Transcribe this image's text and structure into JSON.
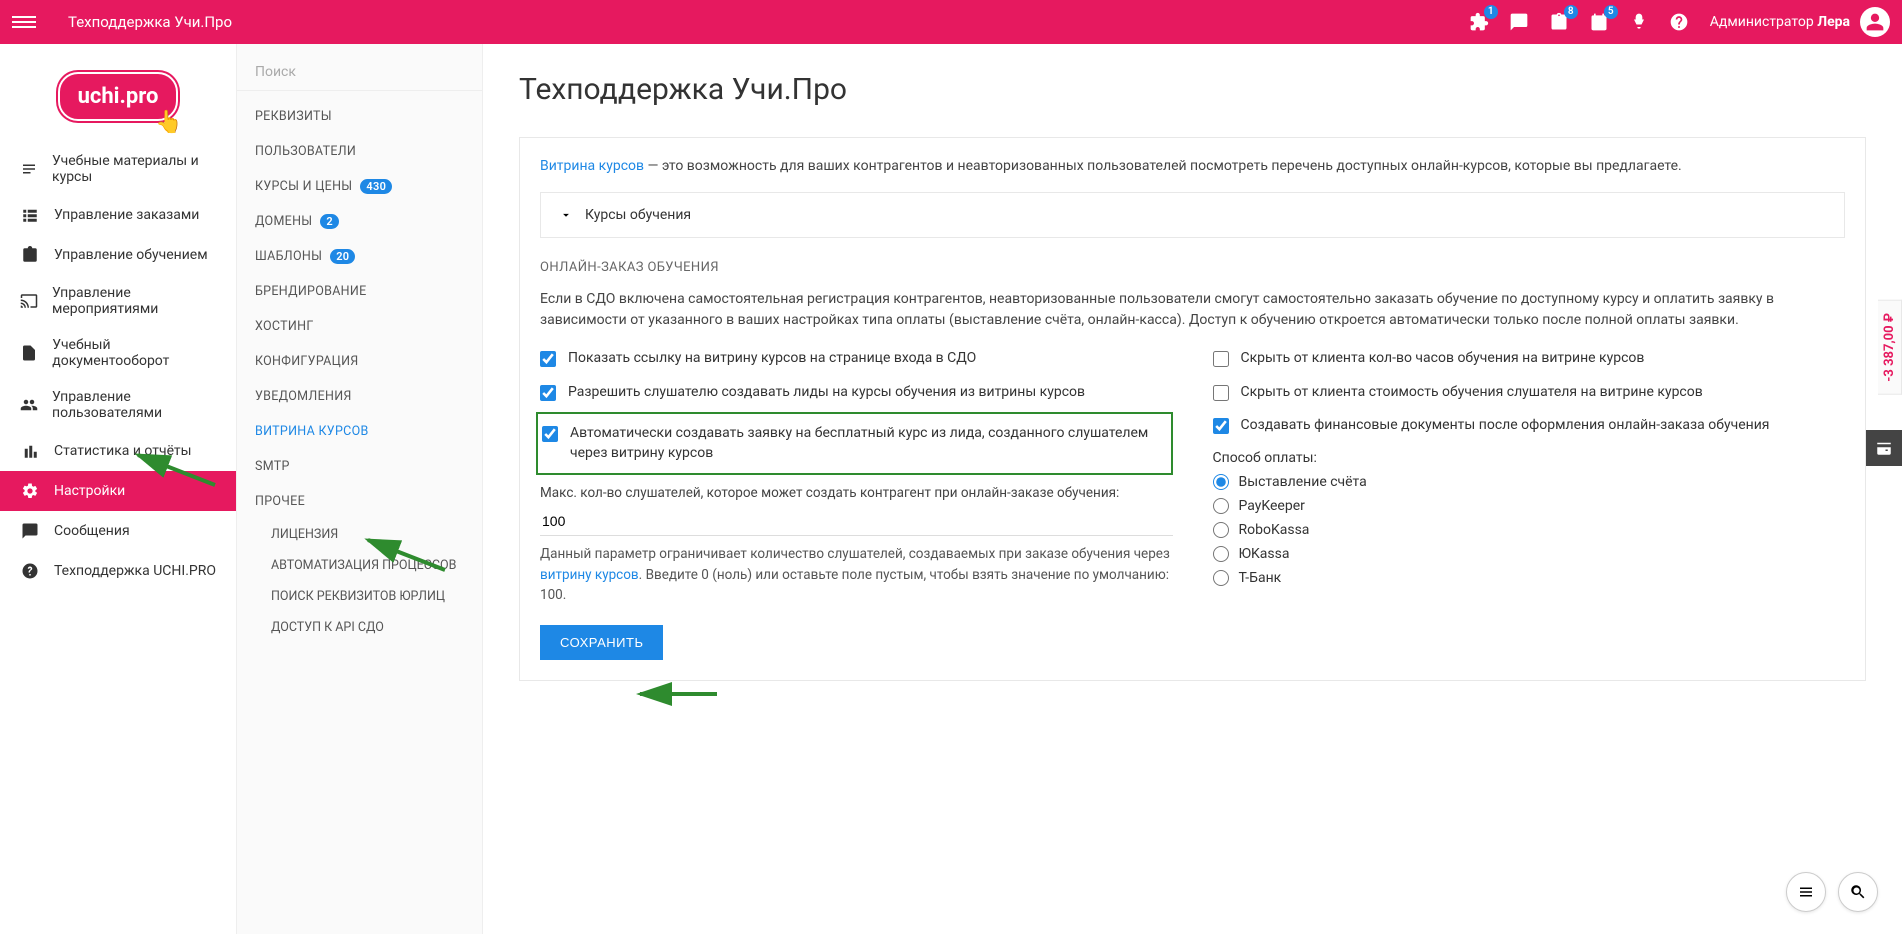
{
  "header": {
    "app_title": "Техподдержка Учи.Про",
    "badges": {
      "b1": "1",
      "b2": "8",
      "b3": "5"
    },
    "user_prefix": "Администратор",
    "user_name": "Лера"
  },
  "sidebar1": {
    "items": [
      "Учебные материалы и курсы",
      "Управление заказами",
      "Управление обучением",
      "Управление мероприятиями",
      "Учебный документооборот",
      "Управление пользователями",
      "Статистика и отчёты",
      "Настройки",
      "Сообщения",
      "Техподдержка UCHI.PRO"
    ],
    "active_index": 7
  },
  "sidebar2": {
    "search_placeholder": "Поиск",
    "items": [
      {
        "label": "РЕКВИЗИТЫ"
      },
      {
        "label": "ПОЛЬЗОВАТЕЛИ"
      },
      {
        "label": "КУРСЫ И ЦЕНЫ",
        "badge": "430"
      },
      {
        "label": "ДОМЕНЫ",
        "badge": "2"
      },
      {
        "label": "ШАБЛОНЫ",
        "badge": "20"
      },
      {
        "label": "БРЕНДИРОВАНИЕ"
      },
      {
        "label": "ХОСТИНГ"
      },
      {
        "label": "КОНФИГУРАЦИЯ"
      },
      {
        "label": "УВЕДОМЛЕНИЯ"
      },
      {
        "label": "ВИТРИНА КУРСОВ",
        "active": true
      },
      {
        "label": "SMTP"
      },
      {
        "label": "ПРОЧЕЕ"
      }
    ],
    "sub_items": [
      "ЛИЦЕНЗИЯ",
      "АВТОМАТИЗАЦИЯ ПРОЦЕССОВ",
      "ПОИСК РЕКВИЗИТОВ ЮРЛИЦ",
      "ДОСТУП К API СДО"
    ]
  },
  "main": {
    "page_title": "Техподдержка Учи.Про",
    "intro_link": "Витрина курсов",
    "intro_rest": " — это возможность для ваших контрагентов и неавторизованных пользователей посмотреть перечень доступных онлайн-курсов, которые вы предлагаете.",
    "accordion_title": "Курсы обучения",
    "section_title": "ОНЛАЙН-ЗАКАЗ ОБУЧЕНИЯ",
    "section_desc": "Если в СДО включена самостоятельная регистрация контрагентов, неавторизованные пользователи смогут самостоятельно заказать обучение по доступному курсу и оплатить заявку в зависимости от указанного в ваших настройках типа оплаты (выставление счёта, онлайн-касса). Доступ к обучению откроется автоматически только после полной оплаты заявки.",
    "left_checks": [
      "Показать ссылку на витрину курсов на странице входа в СДО",
      "Разрешить слушателю создавать лиды на курсы обучения из витрины курсов",
      "Автоматически создавать заявку на бесплатный курс из лида, созданного слушателем через витрину курсов"
    ],
    "max_label": "Макс. кол-во слушателей, которое может создать контрагент при онлайн-заказе обучения:",
    "max_value": "100",
    "helper_pre": "Данный параметр ограничивает количество слушателей, создаваемых при заказе обучения через ",
    "helper_link": "витрину курсов",
    "helper_post": ". Введите 0 (ноль) или оставьте поле пустым, чтобы взять значение по умолчанию: 100.",
    "save_btn": "СОХРАНИТЬ",
    "right_checks": [
      "Скрыть от клиента кол-во часов обучения на витрине курсов",
      "Скрыть от клиента стоимость обучения слушателя на витрине курсов",
      "Создавать финансовые документы после оформления онлайн-заказа обучения"
    ],
    "pay_title": "Способ оплаты:",
    "pay_opts": [
      "Выставление счёта",
      "PayKeeper",
      "RoboKassa",
      "ЮKassa",
      "Т-Банк"
    ]
  },
  "price_tab": "-3 387,00 ₽"
}
